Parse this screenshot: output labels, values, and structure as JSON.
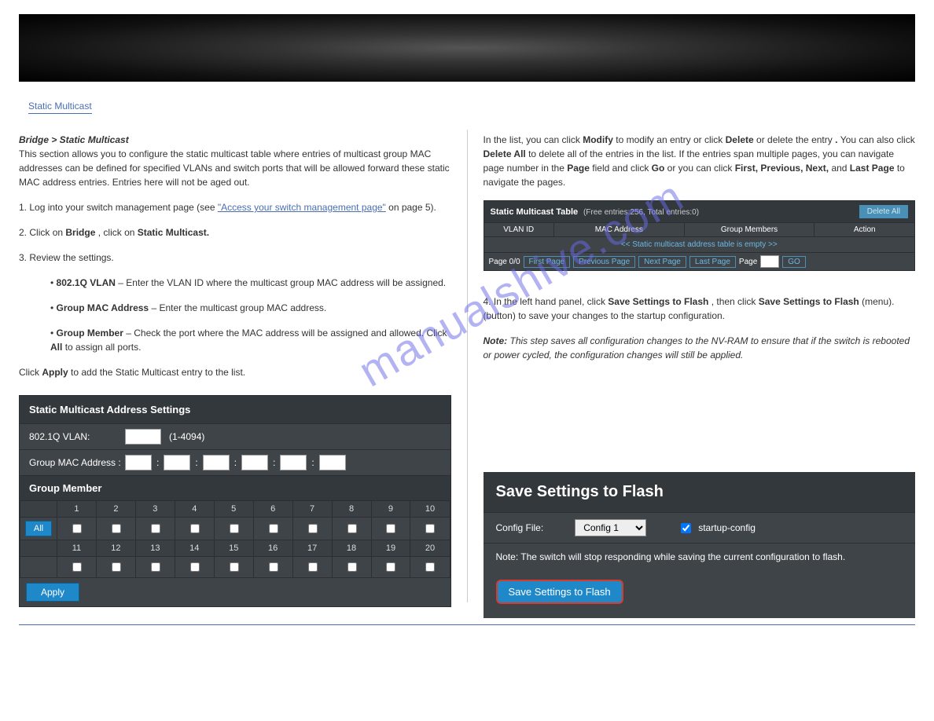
{
  "watermark": "manualshive.com",
  "heading": "Static Multicast",
  "left": {
    "intro_prefix": "Bridge > Static Multicast",
    "intro_body": "This section allows you to configure the static multicast table where entries of multicast group MAC addresses can be defined for specified VLANs and switch ports that will be allowed forward these static MAC address entries. Entries here will not be aged out.",
    "step1_num": "1.",
    "step1_text": "Log into your switch management page (see ",
    "step1_link": "\"Access your switch management page\"",
    "step1_after": " on page 5).",
    "step2_num": "2.",
    "step2_text_a": "Click on ",
    "step2_b1": "Bridge",
    "step2_mid": ", click on ",
    "step2_b2": "Static Multicast.",
    "step3_num": "3.",
    "step3_text": "Review the settings.",
    "bullet1_label": "802.1Q VLAN",
    "bullet1_text": " – Enter the VLAN ID where the multicast group MAC address will be assigned.",
    "bullet2_label": "Group MAC Address",
    "bullet2_text": " – Enter the multicast group MAC address.",
    "bullet3_label": "Group Member",
    "bullet3_text_a": " – Check the port where the MAC address will be assigned and allowed. Click ",
    "bullet3_all": "All",
    "bullet3_text_b": " to assign all ports.",
    "apply_line_a": "Click ",
    "apply_bold": "Apply",
    "apply_line_b": " to add the Static Multicast entry to the list.",
    "panel": {
      "header": "Static Multicast Address Settings",
      "vlan_label": "802.1Q VLAN:",
      "vlan_range": "(1-4094)",
      "mac_label": "Group MAC Address :",
      "group_header": "Group Member",
      "all_btn": "All",
      "ports_r1": [
        "1",
        "2",
        "3",
        "4",
        "5",
        "6",
        "7",
        "8",
        "9",
        "10"
      ],
      "ports_r2": [
        "11",
        "12",
        "13",
        "14",
        "15",
        "16",
        "17",
        "18",
        "19",
        "20"
      ],
      "apply": "Apply"
    }
  },
  "right": {
    "table": {
      "title": "Static Multicast Table",
      "sub": "(Free entries:256, Total entries:0)",
      "delete_all": "Delete All",
      "cols": {
        "c1": "VLAN ID",
        "c2": "MAC Address",
        "c3": "Group Members",
        "c4": "Action"
      },
      "empty": "<< Static multicast address table is empty >>",
      "page_info": "Page 0/0",
      "first": "First Page",
      "prev": "Previous Page",
      "next": "Next Page",
      "last": "Last Page",
      "page_label": "Page",
      "go": "GO"
    },
    "list_text_a": "In the list, you can click ",
    "list_b1": "Modify",
    "list_text_b": " to modify an entry or click ",
    "list_b2": "Delete",
    "list_text_c": " or delete the entry",
    "list_b3": ". ",
    "list_text_d": "You can also click ",
    "list_b4": "Delete All",
    "list_text_e": " to delete all of the entries in the list. If the entries span multiple pages, you can navigate page number in the ",
    "list_b5": "Page",
    "list_text_f": " field and click ",
    "list_b6": "Go",
    "list_text_g": " or you can click ",
    "list_b7": "First, Previous, Next,",
    "list_text_h": " and ",
    "list_b8": "Last Page",
    "list_text_i": " to navigate the pages.",
    "step4_num": "4.",
    "step4_a": "In the left hand panel, click ",
    "step4_b1": "Save Settings to Flash",
    "step4_mid": ", then click ",
    "step4_b2": "Save Settings to Flash",
    "step4_end": " (menu). (button) to save your changes to the startup configuration.",
    "note_label": "Note:",
    "note_text": " This step saves all configuration changes to the NV-RAM to ensure that if the switch is rebooted or power cycled, the configuration changes will still be applied.",
    "flash": {
      "heading": "Save Settings to Flash",
      "config_label": "Config File:",
      "config_selected": "Config 1",
      "startup": "startup-config",
      "note": "Note: The switch will stop responding while saving the current configuration to flash.",
      "button": "Save Settings to Flash"
    }
  }
}
